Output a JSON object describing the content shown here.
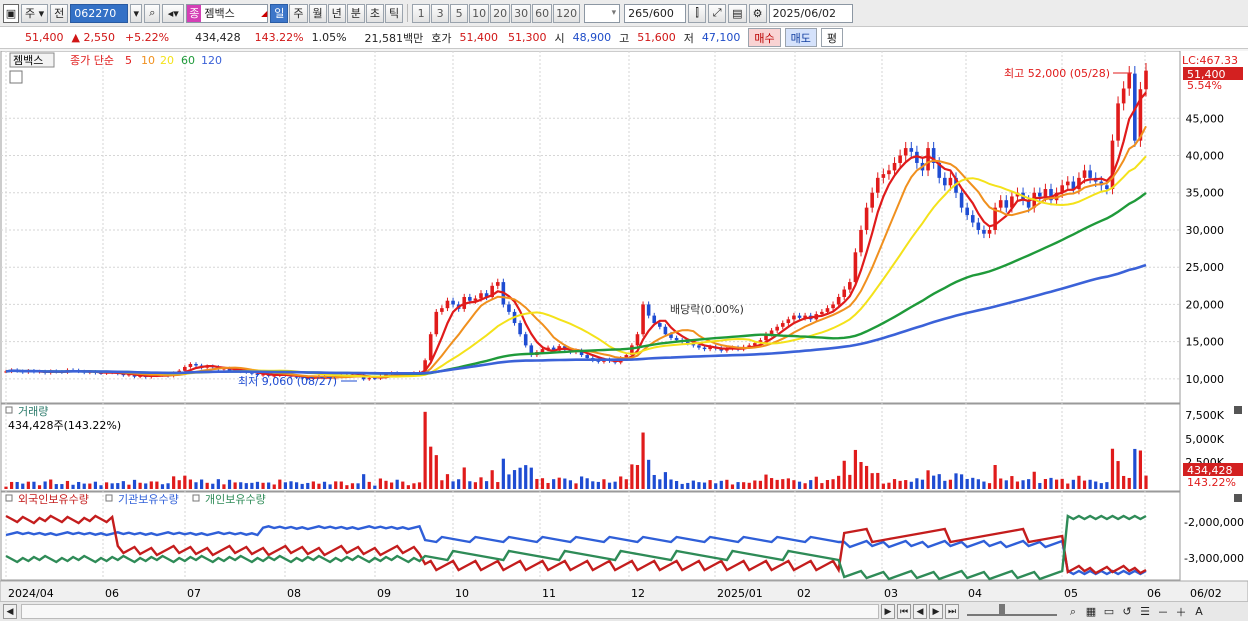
{
  "toolbar": {
    "main_icon": "chart-window-icon",
    "period_dd": "주",
    "prev": "전",
    "code": "062270",
    "stock_badge": "종",
    "stock_name": "젬백스",
    "periods": [
      {
        "label": "일",
        "selected": true
      },
      {
        "label": "주"
      },
      {
        "label": "월"
      },
      {
        "label": "년"
      },
      {
        "label": "분"
      },
      {
        "label": "초"
      },
      {
        "label": "틱"
      }
    ],
    "nums": [
      "1",
      "3",
      "5",
      "10",
      "20",
      "30",
      "60",
      "120"
    ],
    "count": "265",
    "total": "/600",
    "date": "2025/06/02"
  },
  "quote": {
    "price": "51,400",
    "change": "▲ 2,550",
    "pct": "+5.22%",
    "volume": "434,428",
    "vol_ratio": "143.22%",
    "turnover": "1.05%",
    "amount": "21,581백만",
    "ask_label": "호가",
    "ask1": "51,400",
    "ask2": "51,300",
    "open_label": "시",
    "open": "48,900",
    "high_label": "고",
    "high": "51,600",
    "low_label": "저",
    "low": "47,100",
    "buy": "매수",
    "sell": "매도",
    "eval": "평"
  },
  "colors": {
    "up": "#e01b1b",
    "down": "#1e4cd2",
    "ma5": "#e01b1b",
    "ma10": "#f0901e",
    "ma20": "#f4e21a",
    "ma60": "#1f9a3a",
    "ma120": "#3b62d8",
    "foreign": "#2f5fd8",
    "institution": "#c41d1d",
    "individual": "#2e8b57",
    "grid": "#d6d6d6"
  },
  "chart_data": [
    {
      "type": "candlestick",
      "legend": {
        "name": "젬백스",
        "ma_label": "종가 단순",
        "periods": [
          "5",
          "10",
          "20",
          "60",
          "120"
        ]
      },
      "y_ticks": [
        "45,000",
        "40,000",
        "35,000",
        "30,000",
        "25,000",
        "20,000",
        "15,000",
        "10,000"
      ],
      "ylim": [
        7300,
        53500
      ],
      "lc_label": "LC:467.33",
      "last_price": "51,400",
      "last_pct": "5.54%",
      "annot_high": "최고 52,000 (05/28)",
      "annot_low": "최저 9,060 (08/27)",
      "annot_div": "배당락(0.00%)",
      "close": [
        11000,
        11200,
        11050,
        10900,
        11100,
        10950,
        11000,
        10800,
        11050,
        10950,
        10900,
        11200,
        11150,
        11000,
        10850,
        10950,
        10800,
        10750,
        10900,
        10850,
        10700,
        10500,
        10600,
        10300,
        10400,
        10250,
        10450,
        10600,
        10500,
        10400,
        10800,
        11100,
        11600,
        12000,
        11800,
        11500,
        11700,
        11600,
        11300,
        11400,
        11100,
        11200,
        11000,
        10900,
        10700,
        10500,
        10600,
        10400,
        10450,
        10700,
        10500,
        10300,
        10200,
        10100,
        10000,
        10250,
        10350,
        10200,
        10100,
        10300,
        10450,
        10500,
        10600,
        10550,
        9950,
        10100,
        10050,
        10400,
        10600,
        10800,
        10500,
        10650,
        10700,
        10800,
        10900,
        12500,
        16000,
        19000,
        19500,
        20500,
        20000,
        19400,
        21000,
        20500,
        20800,
        21500,
        21000,
        22500,
        23000,
        20000,
        19000,
        17500,
        16000,
        14500,
        13200,
        13600,
        14000,
        14200,
        13800,
        14400,
        13900,
        13600,
        13800,
        13200,
        12800,
        12500,
        12300,
        12600,
        12400,
        12200,
        12800,
        13200,
        14500,
        16000,
        20000,
        18500,
        17500,
        17000,
        16000,
        15500,
        15200,
        15000,
        14800,
        14500,
        14200,
        14000,
        14300,
        14100,
        13800,
        14100,
        14200,
        14000,
        14300,
        14500,
        14800,
        15200,
        16000,
        16500,
        17000,
        17500,
        18000,
        18500,
        18200,
        18500,
        18000,
        18700,
        19000,
        19500,
        20000,
        21000,
        22000,
        23000,
        27000,
        30000,
        33000,
        35000,
        37000,
        37500,
        38000,
        39000,
        40000,
        41000,
        40500,
        39000,
        38000,
        41000,
        39000,
        37000,
        36000,
        37000,
        35000,
        33000,
        32000,
        31000,
        30000,
        29500,
        30000,
        33000,
        34000,
        33000,
        34500,
        35000,
        34000,
        33000,
        35000,
        34500,
        35500,
        34000,
        35000,
        36000,
        36500,
        35500,
        37000,
        38000,
        37000,
        36500,
        36000,
        35500,
        42000,
        47000,
        49000,
        51000,
        42000,
        48900,
        51400
      ],
      "volume_ticks": [
        "7,500K",
        "5,000K",
        "2,500K"
      ],
      "volume_label": "거래량",
      "volume_info": "434,428주(143.22%)",
      "volume_now": "434,428",
      "volume_pct": "143.22%"
    },
    {
      "type": "line",
      "legend": [
        "외국인보유수량",
        "기관보유수량",
        "개인보유수량"
      ],
      "y_ticks": [
        "-2,000,000",
        "-3,000,000"
      ]
    }
  ],
  "x_labels": [
    "2024/04",
    "06",
    "07",
    "08",
    "09",
    "10",
    "11",
    "12",
    "2025/01",
    "02",
    "03",
    "04",
    "05",
    "06",
    "06/02"
  ],
  "footer": {
    "icons": [
      "scroll-left-icon",
      "pager-icons",
      "zoom-icons"
    ]
  }
}
